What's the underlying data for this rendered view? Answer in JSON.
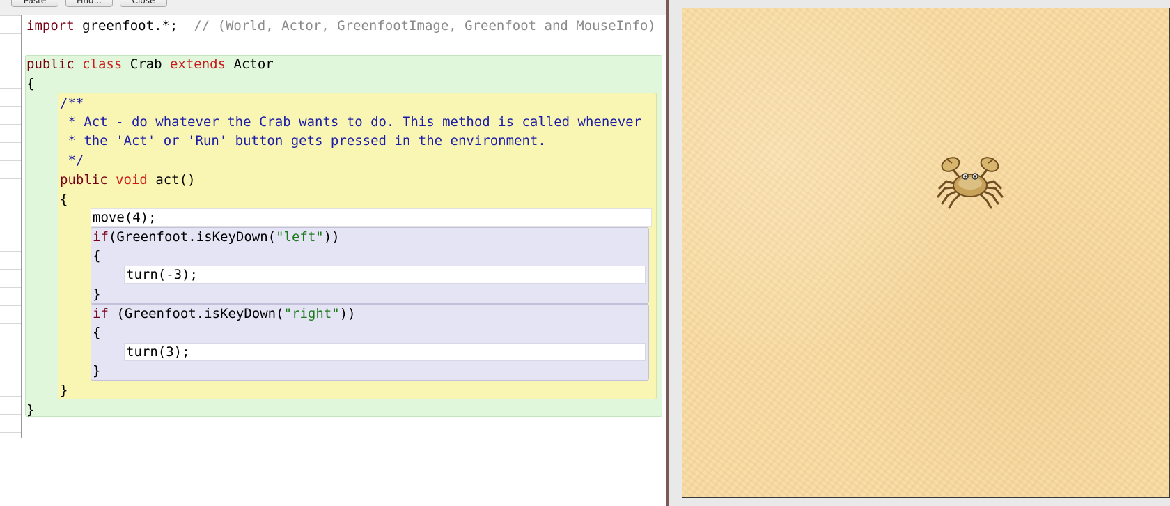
{
  "toolbar": {
    "buttons": [
      "Paste",
      "Find...",
      "Close"
    ]
  },
  "code": {
    "import_kw": "import",
    "import_rest": " greenfoot.*;",
    "import_comment": "  // (World, Actor, GreenfootImage, Greenfoot and MouseInfo)",
    "cls_public": "public",
    "cls_class": "class",
    "cls_name": "Crab",
    "cls_extends": "extends",
    "cls_super": "Actor",
    "open_brace": "{",
    "close_brace": "}",
    "doc_start": "/**",
    "doc_line1": " * Act - do whatever the Crab wants to do. This method is called whenever",
    "doc_line2": " * the 'Act' or 'Run' button gets pressed in the environment.",
    "doc_end": " */",
    "m_public": "public",
    "m_void": "void",
    "m_sig": "act()",
    "move_stmt": "move(4);",
    "if1_kw": "if",
    "if1_pre": "(Greenfoot.isKeyDown(",
    "if1_str": "\"left\"",
    "if1_post": "))",
    "turn1": "turn(-3);",
    "if2_kw": "if",
    "if2_pre": " (Greenfoot.isKeyDown(",
    "if2_str": "\"right\"",
    "if2_post": "))",
    "turn2": "turn(3);"
  },
  "world": {
    "actor": "crab-icon",
    "background_color": "#f8dca4"
  }
}
